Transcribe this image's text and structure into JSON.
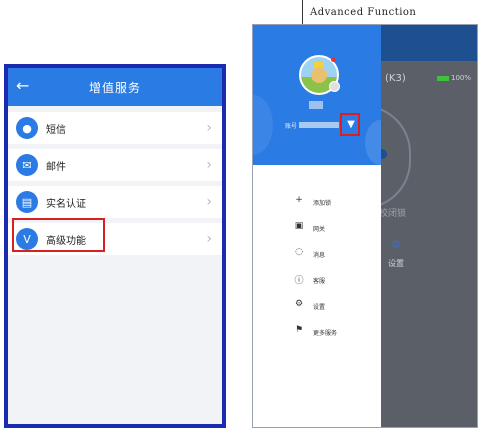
{
  "left_screen": {
    "header": {
      "title": "增值服务",
      "back_icon": "arrow-left-icon"
    },
    "items": [
      {
        "label": "短信",
        "icon": "message-bubble-icon"
      },
      {
        "label": "邮件",
        "icon": "envelope-icon"
      },
      {
        "label": "实名认证",
        "icon": "id-card-icon"
      },
      {
        "label": "高级功能",
        "icon": "v-badge-icon"
      }
    ],
    "colors": {
      "accent": "#2a7be4",
      "frame": "#1a2bb0",
      "highlight": "#d82020"
    }
  },
  "callout": {
    "text": "Advanced Function"
  },
  "right_screen": {
    "drawer": {
      "account_label": "账号",
      "menu": [
        {
          "label": "添加锁",
          "icon": "plus-icon",
          "glyph": "+"
        },
        {
          "label": "网关",
          "icon": "gateway-icon",
          "glyph": "▣"
        },
        {
          "label": "消息",
          "icon": "chat-icon",
          "glyph": "◌"
        },
        {
          "label": "客服",
          "icon": "info-icon",
          "glyph": "ⓘ"
        },
        {
          "label": "设置",
          "icon": "gear-icon",
          "glyph": "⚙"
        },
        {
          "label": "更多服务",
          "icon": "bookmark-icon",
          "glyph": "⚑"
        }
      ]
    },
    "background_app": {
      "device_name": "(K3)",
      "battery_text": "100%",
      "status_text": "校闭锁",
      "settings_label": "设置"
    }
  }
}
